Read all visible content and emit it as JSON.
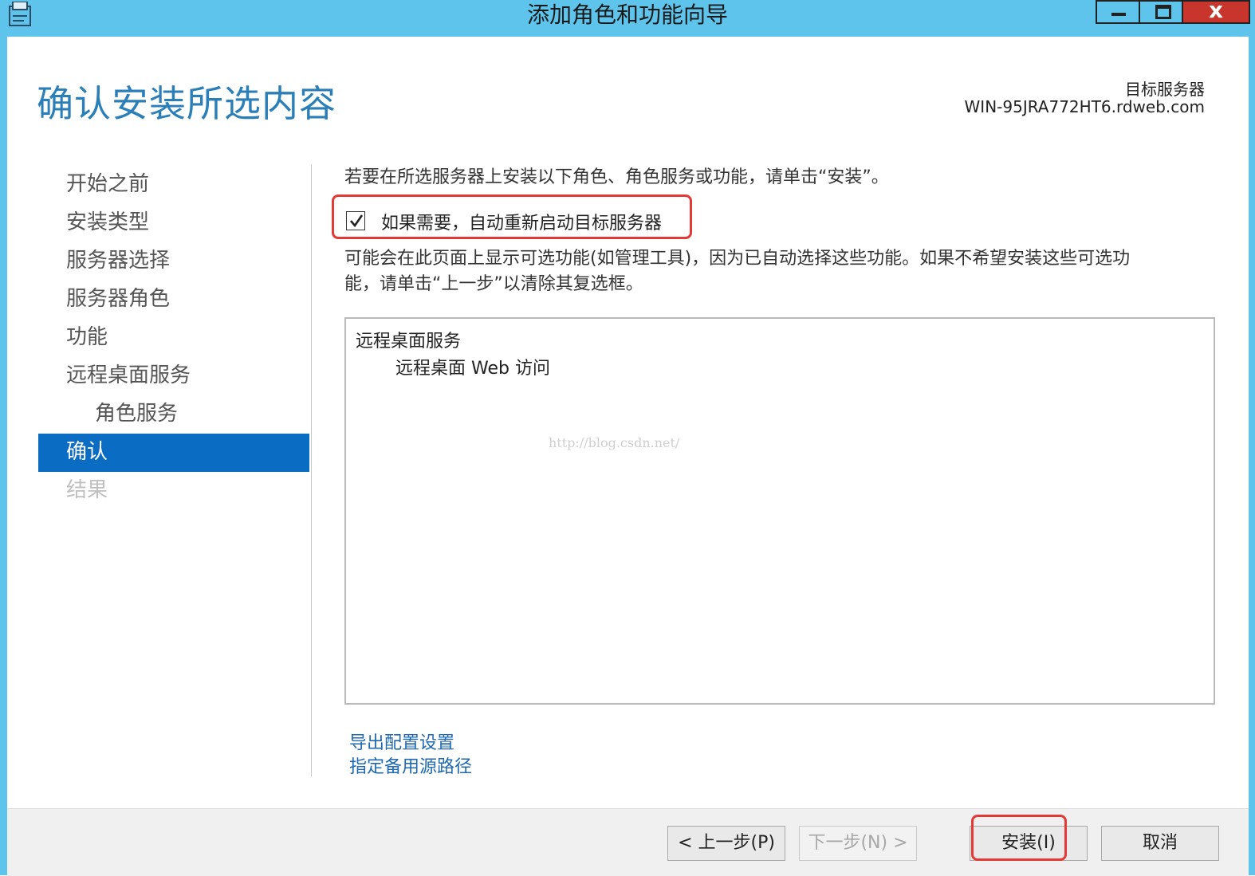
{
  "window": {
    "title": "添加角色和功能向导",
    "close_glyph": "x"
  },
  "header": {
    "page_title": "确认安装所选内容",
    "target_label": "目标服务器",
    "target_server": "WIN-95JRA772HT6.rdweb.com"
  },
  "nav": {
    "items": [
      {
        "label": "开始之前",
        "state": "normal"
      },
      {
        "label": "安装类型",
        "state": "normal"
      },
      {
        "label": "服务器选择",
        "state": "normal"
      },
      {
        "label": "服务器角色",
        "state": "normal"
      },
      {
        "label": "功能",
        "state": "normal"
      },
      {
        "label": "远程桌面服务",
        "state": "normal"
      },
      {
        "label": "角色服务",
        "state": "sub"
      },
      {
        "label": "确认",
        "state": "active"
      },
      {
        "label": "结果",
        "state": "disabled"
      }
    ]
  },
  "content": {
    "intro": "若要在所选服务器上安装以下角色、角色服务或功能，请单击“安装”。",
    "restart_checkbox": {
      "label": "如果需要，自动重新启动目标服务器",
      "checked": true
    },
    "note_line1": "可能会在此页面上显示可选功能(如管理工具)，因为已自动选择这些功能。如果不希望安装这些可选功",
    "note_line2": "能，请单击“上一步”以清除其复选框。",
    "selection": {
      "parent": "远程桌面服务",
      "child": "远程桌面 Web 访问"
    },
    "watermark": "http://blog.csdn.net/",
    "links": {
      "export": "导出配置设置",
      "source": "指定备用源路径"
    }
  },
  "footer": {
    "prev": "< 上一步(P)",
    "next": "下一步(N) >",
    "install": "安装(I)",
    "cancel": "取消"
  },
  "colors": {
    "titlebar": "#5ec4ec",
    "accent_title": "#2b7fb8",
    "nav_active": "#0a6cc3",
    "link": "#1f69b0",
    "highlight": "#e53935",
    "close_button": "#c7352c"
  }
}
